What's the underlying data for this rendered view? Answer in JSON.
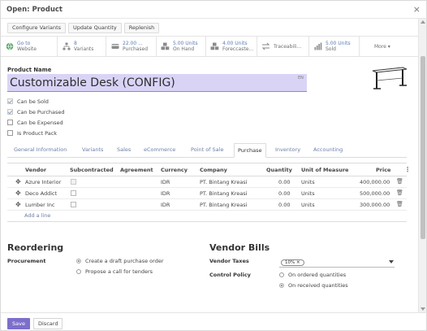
{
  "dialog": {
    "title": "Open: Product"
  },
  "header_actions": [
    "Configure Variants",
    "Update Quantity",
    "Replenish"
  ],
  "smart_buttons": [
    {
      "icon": "globe-icon",
      "value": "Go to",
      "label": "Website"
    },
    {
      "icon": "sitemap-icon",
      "value": "8",
      "label": "Variants"
    },
    {
      "icon": "credit-card-icon",
      "value": "22.00 ...",
      "label": "Purchased"
    },
    {
      "icon": "cubes-icon",
      "value": "5.00 Units",
      "label": "On Hand"
    },
    {
      "icon": "cubes-icon",
      "value": "4.00 Units",
      "label": "Foreccaste..."
    },
    {
      "icon": "exchange-icon",
      "value": "",
      "label": "Traceabili..."
    },
    {
      "icon": "bar-chart-icon",
      "value": "5.00 Units",
      "label": "Sold"
    },
    {
      "icon": "",
      "value": "",
      "label": "More ▾"
    }
  ],
  "product": {
    "name_label": "Product Name",
    "name": "Customizable Desk (CONFIG)",
    "lang": "EN"
  },
  "flags": [
    {
      "label": "Can be Sold",
      "checked": true
    },
    {
      "label": "Can be Purchased",
      "checked": true
    },
    {
      "label": "Can be Expensed",
      "checked": false
    },
    {
      "label": "Is Product Pack",
      "checked": false
    }
  ],
  "tabs": [
    "General Information",
    "Variants",
    "Sales",
    "eCommerce",
    "Point of Sale",
    "Purchase",
    "Inventory",
    "Accounting"
  ],
  "active_tab": "Purchase",
  "vendors_table": {
    "columns": [
      "Vendor",
      "Subcontracted",
      "Agreement",
      "Currency",
      "Company",
      "Quantity",
      "Unit of Measure",
      "Price"
    ],
    "rows": [
      {
        "vendor": "Azure Interior",
        "subcontracted": true,
        "agreement": "",
        "currency": "IDR",
        "company": "PT. Bintang Kreasi",
        "quantity": "0.00",
        "uom": "Units",
        "price": "400,000.00"
      },
      {
        "vendor": "Deco Addict",
        "subcontracted": false,
        "agreement": "",
        "currency": "IDR",
        "company": "PT. Bintang Kreasi",
        "quantity": "0.00",
        "uom": "Units",
        "price": "500,000.00"
      },
      {
        "vendor": "Lumber Inc",
        "subcontracted": false,
        "agreement": "",
        "currency": "IDR",
        "company": "PT. Bintang Kreasi",
        "quantity": "0.00",
        "uom": "Units",
        "price": "300,000.00"
      }
    ],
    "add_line": "Add a line"
  },
  "reordering": {
    "title": "Reordering",
    "procurement_label": "Procurement",
    "options": [
      {
        "label": "Create a draft purchase order",
        "selected": true
      },
      {
        "label": "Propose a call for tenders",
        "selected": false
      }
    ]
  },
  "vendor_bills": {
    "title": "Vendor Bills",
    "taxes_label": "Vendor Taxes",
    "tax_tag": "10%",
    "control_label": "Control Policy",
    "options": [
      {
        "label": "On ordered quantities",
        "selected": false
      },
      {
        "label": "On received quantities",
        "selected": true
      }
    ]
  },
  "footer": {
    "save": "Save",
    "discard": "Discard"
  },
  "colors": {
    "primary": "#7c6fcb",
    "name_field_bg": "#d9d4f6",
    "link": "#6b7fa6"
  }
}
